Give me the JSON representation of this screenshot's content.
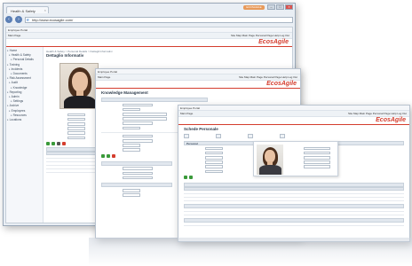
{
  "browser": {
    "tab_title": "Health & Safety",
    "tab_close": "×",
    "address": "http://www.ecosagile.com/",
    "logo_badge": "ECOSAGILE",
    "ie_icon": "ie-logo-icon",
    "back_icon": "back-arrow-icon",
    "forward_icon": "forward-arrow-icon"
  },
  "app": {
    "brand": "EcosAgile",
    "brand_color": "#d43d2e",
    "header_text": "Employee Portal",
    "menu_left": "Main Page",
    "menu_right": "Site Map   Main Page   Personal Page   Help   Log Out"
  },
  "window1": {
    "breadcrumb": "Health & Safety > Personal Details > Dettagli Informativi",
    "title": "Dettaglio Informativ",
    "tree": [
      "Home",
      "Health & Safety",
      "Personal Details",
      "Training",
      "Incidents",
      "Documents",
      "Risk Assessment",
      "Audit",
      "Knowledge",
      "Reporting",
      "Admin",
      "Settings",
      "Archive",
      "Employees",
      "Resources",
      "Locations"
    ]
  },
  "window2": {
    "title": "Knowledge Management",
    "header": "Employee Portal",
    "menu": "Main Page"
  },
  "window3": {
    "title": "Schede Personale",
    "header": "Employee Portal",
    "section": "Personal"
  }
}
